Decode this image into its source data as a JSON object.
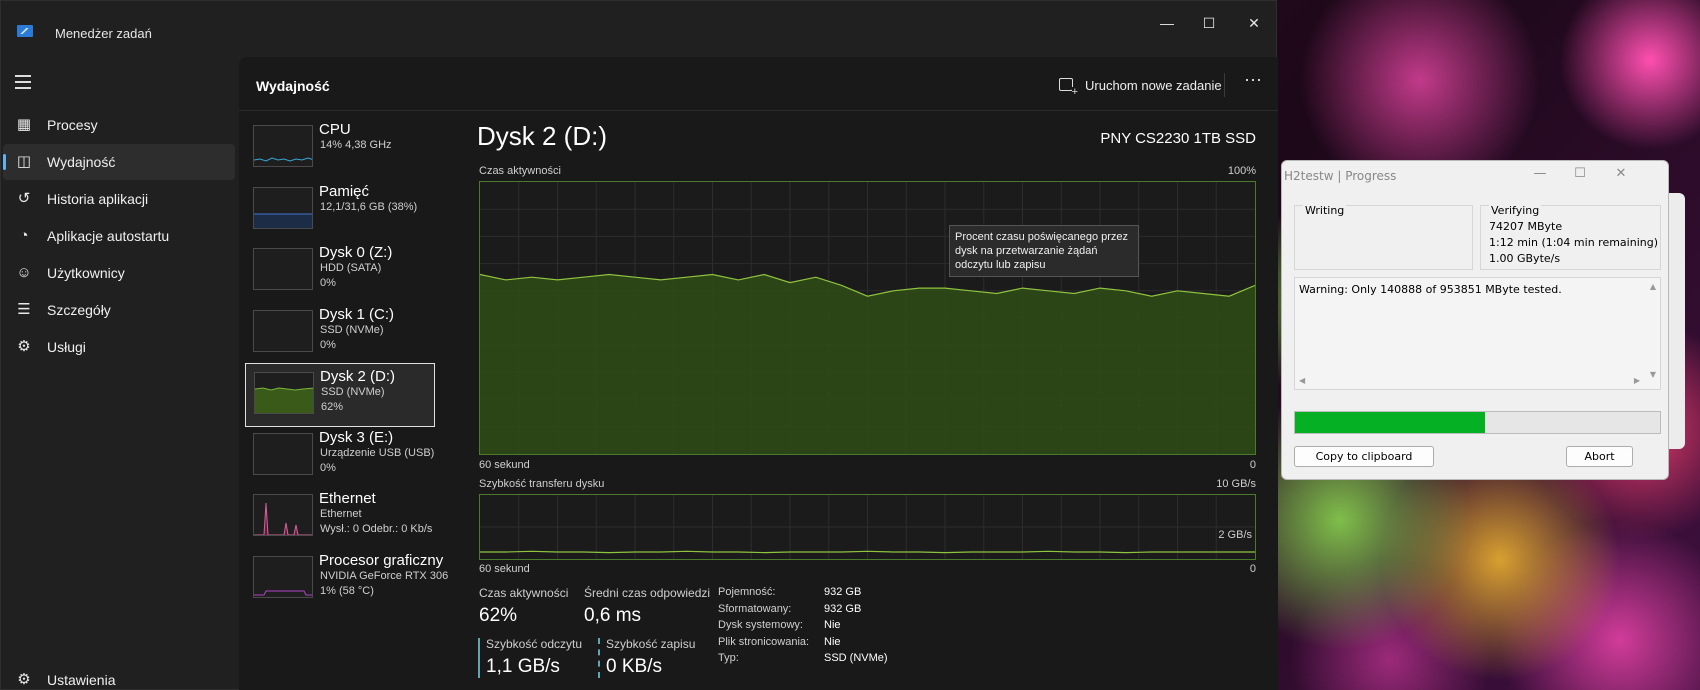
{
  "window": {
    "title": "Menedżer zadań",
    "min": "—",
    "max": "☐",
    "close": "✕"
  },
  "nav": {
    "items": [
      {
        "label": "Procesy",
        "icon": "processes-icon",
        "active": false
      },
      {
        "label": "Wydajność",
        "icon": "performance-icon",
        "active": true
      },
      {
        "label": "Historia aplikacji",
        "icon": "app-history-icon",
        "active": false
      },
      {
        "label": "Aplikacje autostartu",
        "icon": "startup-apps-icon",
        "active": false
      },
      {
        "label": "Użytkownicy",
        "icon": "users-icon",
        "active": false
      },
      {
        "label": "Szczegóły",
        "icon": "details-icon",
        "active": false
      },
      {
        "label": "Usługi",
        "icon": "services-icon",
        "active": false
      }
    ],
    "settings": "Ustawienia"
  },
  "header": {
    "title": "Wydajność",
    "new_task": "Uruchom nowe zadanie",
    "more": "···"
  },
  "devices": [
    {
      "name": "CPU",
      "sub": "14% 4,38 GHz",
      "value": "",
      "color": "#3aa6d6"
    },
    {
      "name": "Pamięć",
      "sub": "12,1/31,6 GB (38%)",
      "value": "",
      "color": "#3e74c8"
    },
    {
      "name": "Dysk 0 (Z:)",
      "sub": "HDD (SATA)",
      "value": "0%",
      "color": "#7bb53a"
    },
    {
      "name": "Dysk 1 (C:)",
      "sub": "SSD (NVMe)",
      "value": "0%",
      "color": "#7bb53a"
    },
    {
      "name": "Dysk 2 (D:)",
      "sub": "SSD (NVMe)",
      "value": "62%",
      "color": "#7bb53a",
      "active": true
    },
    {
      "name": "Dysk 3 (E:)",
      "sub": "Urządzenie USB (USB)",
      "value": "0%",
      "color": "#7bb53a"
    },
    {
      "name": "Ethernet",
      "sub": "Ethernet",
      "value": "Wysł.: 0 Odebr.: 0 Kb/s",
      "color": "#d6609a"
    },
    {
      "name": "Procesor graficzny",
      "sub": "NVIDIA GeForce RTX 306",
      "value": "1% (58 °C)",
      "color": "#b044c8"
    }
  ],
  "detail": {
    "title": "Dysk 2 (D:)",
    "model": "PNY CS2230 1TB SSD",
    "activity_label": "Czas aktywności",
    "activity_max": "100%",
    "activity_xlabel": "60 sekund",
    "activity_xmin": "0",
    "transfer_label": "Szybkość transferu dysku",
    "transfer_max": "10 GB/s",
    "transfer_mid": "2 GB/s",
    "transfer_xlabel": "60 sekund",
    "transfer_xmin": "0",
    "tooltip": "Procent czasu poświęcanego przez dysk na przetwarzanie żądań odczytu lub zapisu",
    "stats": {
      "active_label": "Czas aktywności",
      "active_value": "62%",
      "resp_label": "Średni czas odpowiedzi",
      "resp_value": "0,6 ms",
      "read_label": "Szybkość odczytu",
      "read_value": "1,1 GB/s",
      "write_label": "Szybkość zapisu",
      "write_value": "0 KB/s"
    },
    "props": [
      {
        "k": "Pojemność:",
        "v": "932 GB"
      },
      {
        "k": "Sformatowany:",
        "v": "932 GB"
      },
      {
        "k": "Dysk systemowy:",
        "v": "Nie"
      },
      {
        "k": "Plik stronicowania:",
        "v": "Nie"
      },
      {
        "k": "Typ:",
        "v": "SSD (NVMe)"
      }
    ]
  },
  "chart_data": {
    "type": "area",
    "x": [
      60,
      58,
      56,
      54,
      52,
      50,
      48,
      46,
      44,
      42,
      40,
      38,
      36,
      34,
      32,
      30,
      28,
      26,
      24,
      22,
      20,
      18,
      16,
      14,
      12,
      10,
      8,
      6,
      4,
      2,
      0
    ],
    "series": [
      {
        "values": [
          66,
          64,
          65,
          64,
          65,
          66,
          65,
          64,
          65,
          66,
          64,
          66,
          63,
          65,
          62,
          58,
          60,
          61,
          61,
          60,
          59,
          61,
          60,
          59,
          61,
          60,
          58,
          60,
          59,
          58,
          62
        ]
      }
    ],
    "ylim": [
      0,
      100
    ]
  },
  "transfer_data": {
    "values": [
      1.1,
      1.1,
      1.2,
      1.1,
      1.1,
      1.0,
      1.1,
      1.1,
      1.2,
      1.1,
      1.1,
      1.0,
      1.1,
      1.1,
      1.1,
      1.2,
      1.1,
      1.1,
      1.0,
      1.1,
      1.1,
      1.1,
      1.2,
      1.1,
      1.1,
      1.0,
      1.1,
      1.1,
      1.1,
      1.1,
      1.1
    ],
    "ylim": [
      0,
      10
    ]
  },
  "h2testw": {
    "title": "H2testw | Progress",
    "writing_label": "Writing",
    "verifying_label": "Verifying",
    "verify_mb": "74207 MByte",
    "verify_time": "1:12 min (1:04 min remaining)",
    "verify_speed": "1.00 GByte/s",
    "warning": "Warning: Only 140888 of 953851 MByte tested.",
    "progress": 0.52,
    "copy_btn": "Copy to clipboard",
    "abort_btn": "Abort"
  }
}
